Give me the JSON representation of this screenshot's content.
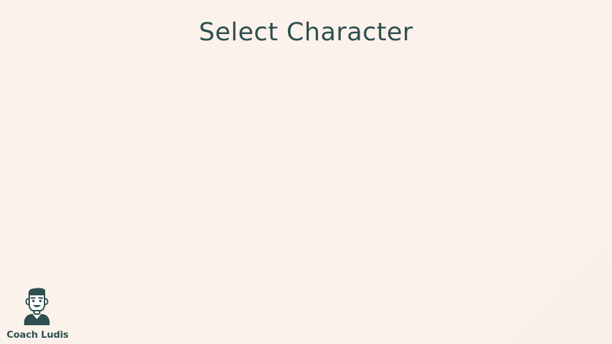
{
  "screen": {
    "title": "Select Character"
  },
  "coach": {
    "name": "Coach Ludis",
    "icon": "coach-avatar-icon"
  },
  "colors": {
    "text": "#2e4f4f",
    "background": "#fbf2ec"
  }
}
